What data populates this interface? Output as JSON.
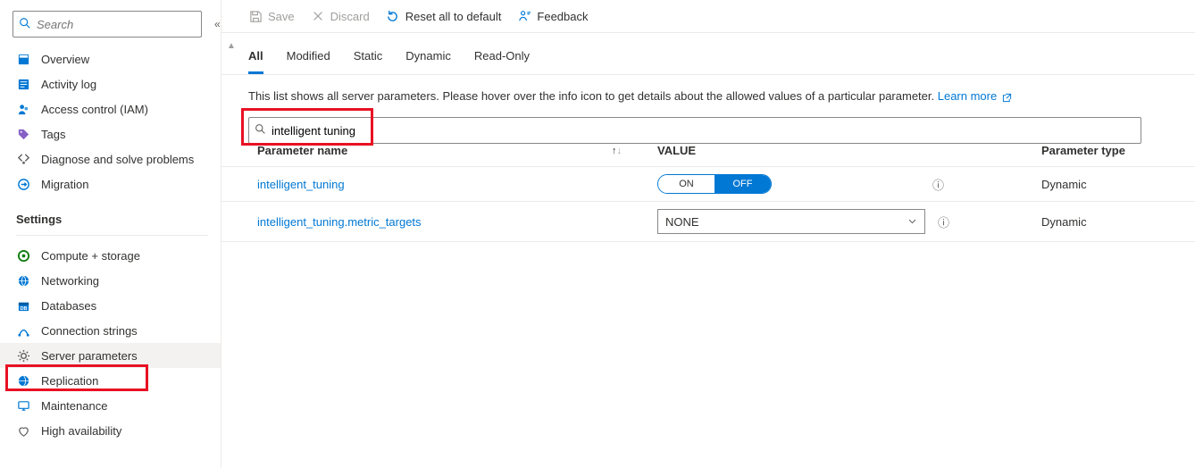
{
  "sidebar": {
    "search_placeholder": "Search",
    "items_top": [
      {
        "label": "Overview",
        "icon": "overview-icon",
        "color": "#0078d4"
      },
      {
        "label": "Activity log",
        "icon": "activity-log-icon",
        "color": "#0078d4"
      },
      {
        "label": "Access control (IAM)",
        "icon": "iam-icon",
        "color": "#0078d4"
      },
      {
        "label": "Tags",
        "icon": "tags-icon",
        "color": "#8661c5"
      },
      {
        "label": "Diagnose and solve problems",
        "icon": "diagnose-icon",
        "color": "#605e5c"
      },
      {
        "label": "Migration",
        "icon": "migration-icon",
        "color": "#0078d4"
      }
    ],
    "settings_header": "Settings",
    "items_settings": [
      {
        "label": "Compute + storage",
        "icon": "compute-icon",
        "color": "#107c10"
      },
      {
        "label": "Networking",
        "icon": "networking-icon",
        "color": "#0078d4"
      },
      {
        "label": "Databases",
        "icon": "databases-icon",
        "color": "#0078d4"
      },
      {
        "label": "Connection strings",
        "icon": "connection-icon",
        "color": "#0078d4"
      },
      {
        "label": "Server parameters",
        "icon": "server-params-icon",
        "color": "#605e5c",
        "selected": true
      },
      {
        "label": "Replication",
        "icon": "replication-icon",
        "color": "#0078d4"
      },
      {
        "label": "Maintenance",
        "icon": "maintenance-icon",
        "color": "#0078d4"
      },
      {
        "label": "High availability",
        "icon": "ha-icon",
        "color": "#605e5c"
      }
    ]
  },
  "toolbar": {
    "save_label": "Save",
    "discard_label": "Discard",
    "reset_label": "Reset all to default",
    "feedback_label": "Feedback"
  },
  "tabs": [
    {
      "label": "All",
      "active": true
    },
    {
      "label": "Modified"
    },
    {
      "label": "Static"
    },
    {
      "label": "Dynamic"
    },
    {
      "label": "Read-Only"
    }
  ],
  "description": {
    "text": "This list shows all server parameters. Please hover over the info icon to get details about the allowed values of a particular parameter. ",
    "learn_more": "Learn more"
  },
  "filter": {
    "value": "intelligent tuning"
  },
  "table": {
    "columns": {
      "name": "Parameter name",
      "value": "VALUE",
      "type": "Parameter type"
    },
    "rows": [
      {
        "name": "intelligent_tuning",
        "value_type": "toggle",
        "on_label": "ON",
        "off_label": "OFF",
        "current": "OFF",
        "type": "Dynamic"
      },
      {
        "name": "intelligent_tuning.metric_targets",
        "value_type": "select",
        "value": "NONE",
        "type": "Dynamic"
      }
    ]
  }
}
